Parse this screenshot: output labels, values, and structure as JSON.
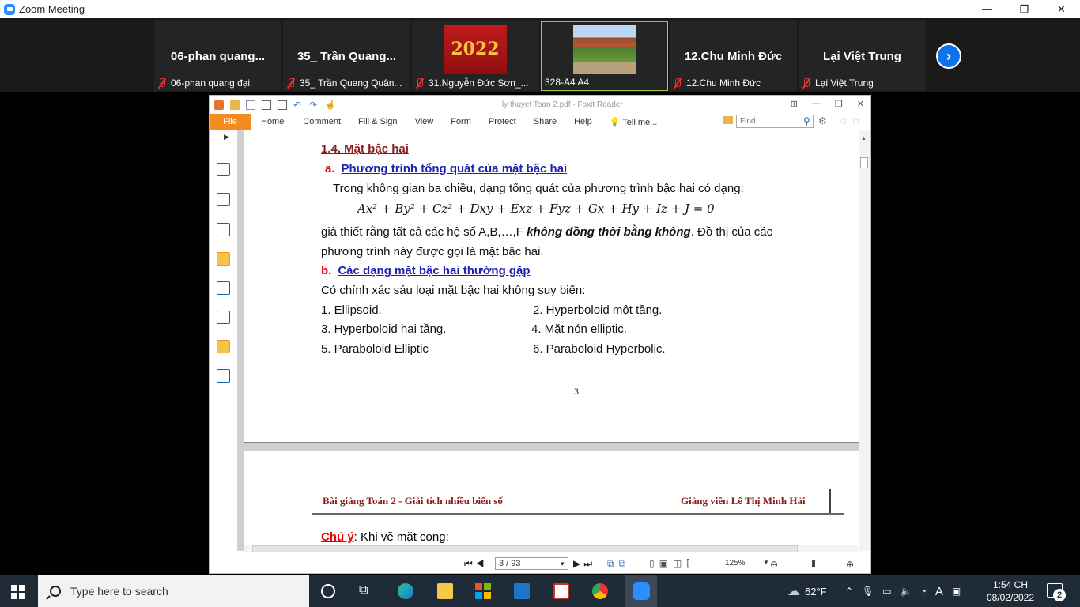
{
  "zoom": {
    "window_title": "Zoom Meeting",
    "controls": [
      "—",
      "❐",
      "✕"
    ],
    "participants": [
      {
        "big": "06-phan  quang...",
        "label": "06-phan quang đại"
      },
      {
        "big": "35_ Trần Quang...",
        "label": "35_ Trần Quang Quân..."
      },
      {
        "big": "2022",
        "label": "31.Nguyễn Đức Sơn_..."
      },
      {
        "big": "",
        "label": "328-A4 A4"
      },
      {
        "big": "12.Chu Minh Đức",
        "label": "12.Chu Minh Đức"
      },
      {
        "big": "Lại Việt Trung",
        "label": "Lại Việt Trung"
      }
    ]
  },
  "foxit": {
    "doc_title": "ly thuyet Toan 2.pdf - Foxit Reader",
    "file_tab": "File",
    "tabs": [
      "Home",
      "Comment",
      "Fill & Sign",
      "View",
      "Form",
      "Protect",
      "Share",
      "Help"
    ],
    "tell_me": "Tell me...",
    "find_placeholder": "Find",
    "page_box": "3 / 93",
    "zoom": "125%"
  },
  "page1": {
    "section_title": "1.4. Mặt bậc hai",
    "sub_a_label": "a.",
    "sub_a_text": "Phương trình tổng quát của mặt bậc hai",
    "intro": "Trong không gian ba chiều, dạng tổng quát của phương trình bậc hai có dạng:",
    "equation": "Ax² + By² + Cz² + Dxy + Exz + Fyz + Gx + Hy + Iz + J = 0",
    "para1_a": "giả thiết rằng tất cả các hệ số A,B,…,F ",
    "para1_bold": "không đồng thời bằng không",
    "para1_b": ". Đồ thị của các",
    "para2": "phương trình này được gọi là mặt bậc hai.",
    "sub_b_label": "b.",
    "sub_b_text": "Các dạng mặt bậc hai thường gặp",
    "list_intro": "Có chính xác sáu loại mặt bậc hai không suy biến:",
    "items": [
      "1.    Ellipsoid.",
      "2.  Hyperboloid một tầng.",
      "3.    Hyperboloid hai tầng.",
      "4.  Mặt nón elliptic.",
      "5.    Paraboloid  Elliptic",
      "6.   Paraboloid Hyperbolic."
    ],
    "page_number": "3"
  },
  "page2": {
    "header_left": "Bài giảng Toán 2 - Giải tích nhiều biến số",
    "header_right": "Giảng viên  Lê Thị Minh Hải",
    "note_label": "Chú ý",
    "note_text": ": Khi vẽ mặt cong:"
  },
  "taskbar": {
    "search_placeholder": "Type here to search",
    "weather": "62°F",
    "time": "1:54 CH",
    "date": "08/02/2022",
    "notif_count": "2",
    "lang": "A"
  }
}
